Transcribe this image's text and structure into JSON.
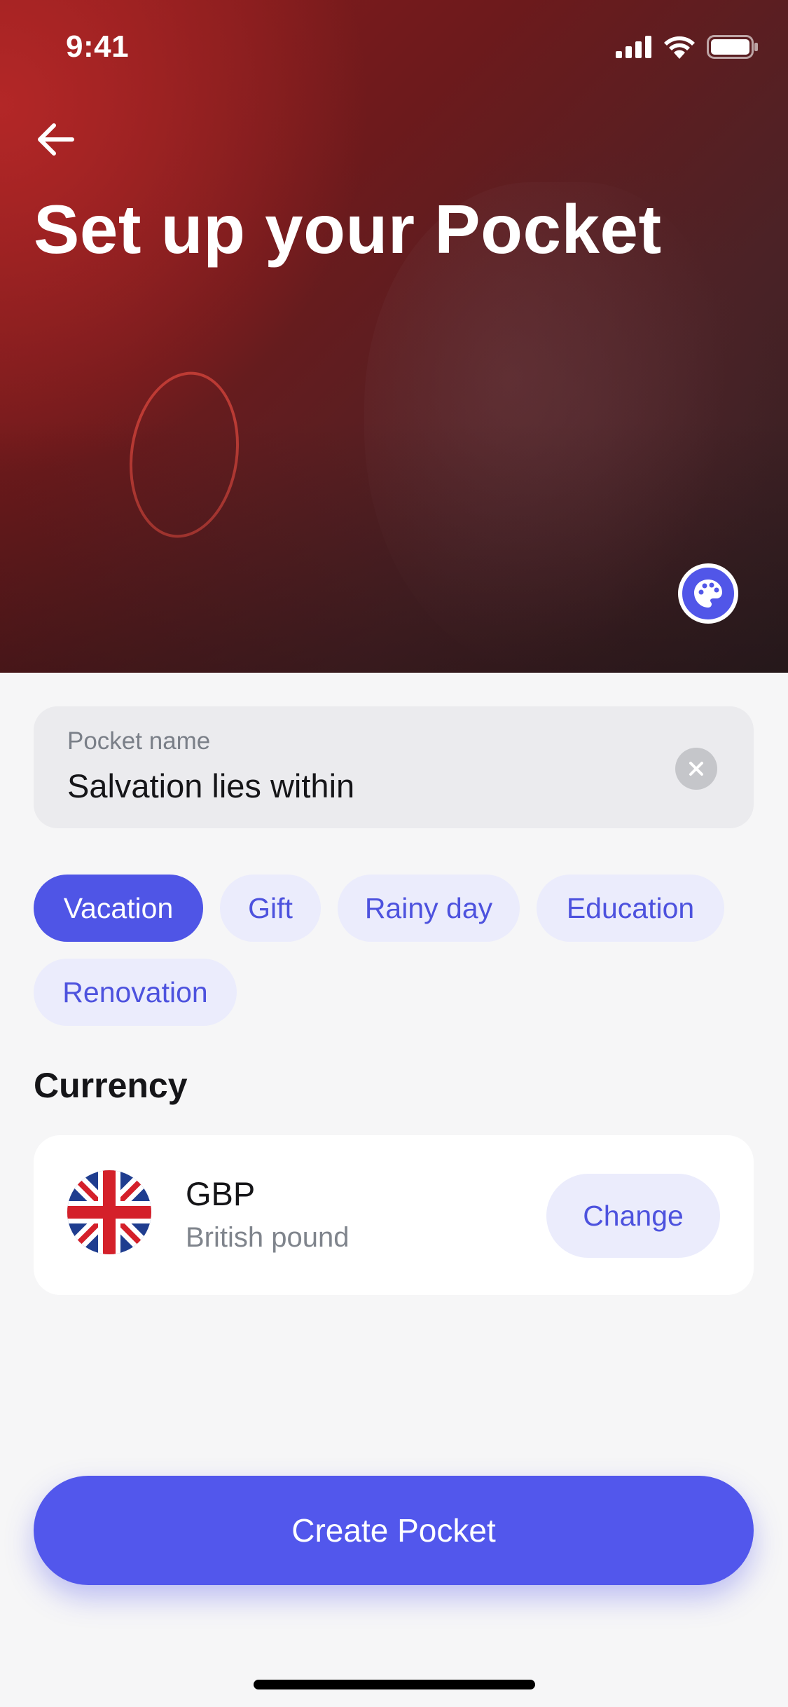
{
  "status_bar": {
    "time": "9:41"
  },
  "header": {
    "title": "Set up your Pocket"
  },
  "pocket_name": {
    "label": "Pocket name",
    "value": "Salvation lies within"
  },
  "categories": [
    {
      "label": "Vacation",
      "selected": true
    },
    {
      "label": "Gift",
      "selected": false
    },
    {
      "label": "Rainy day",
      "selected": false
    },
    {
      "label": "Education",
      "selected": false
    },
    {
      "label": "Renovation",
      "selected": false
    }
  ],
  "currency": {
    "section_title": "Currency",
    "code": "GBP",
    "name": "British pound",
    "change_label": "Change"
  },
  "actions": {
    "create_label": "Create Pocket"
  },
  "colors": {
    "accent": "#5257ec",
    "chip_bg": "#ebecfc",
    "hero_red": "#8e1c1c"
  }
}
